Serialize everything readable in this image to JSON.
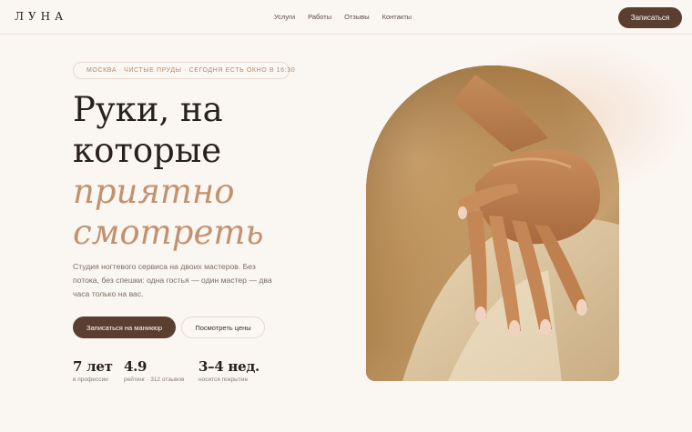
{
  "brand": {
    "logo": "ЛУНА"
  },
  "nav": {
    "items": [
      {
        "label": "Услуги"
      },
      {
        "label": "Работы"
      },
      {
        "label": "Отзывы"
      },
      {
        "label": "Контакты"
      }
    ],
    "cta_label": "Записаться"
  },
  "hero": {
    "location_pill": "МОСКВА · ЧИСТЫЕ ПРУДЫ · СЕГОДНЯ ЕСТЬ ОКНО В 16:30",
    "headline": {
      "line1": "Руки, на",
      "line2": "которые",
      "line3": "приятно",
      "line4": "смотреть"
    },
    "description": "Студия ногтевого сервиса на двоих мастеров. Без потока, без спешки: одна гостья — один мастер — два часа только на вас.",
    "primary_button": "Записаться на маникюр",
    "secondary_button": "Посмотреть цены",
    "stats": [
      {
        "value": "7 лет",
        "label": "в профессии"
      },
      {
        "value": "4.9",
        "label": "рейтинг · 312 отзывов"
      },
      {
        "value": "3–4 нед.",
        "label": "носится покрытие"
      }
    ]
  },
  "colors": {
    "background": "#faf6f1",
    "accent_brown": "#5a3f30",
    "accent_tan": "#c29270"
  },
  "icons": {
    "location": "dot-icon"
  }
}
